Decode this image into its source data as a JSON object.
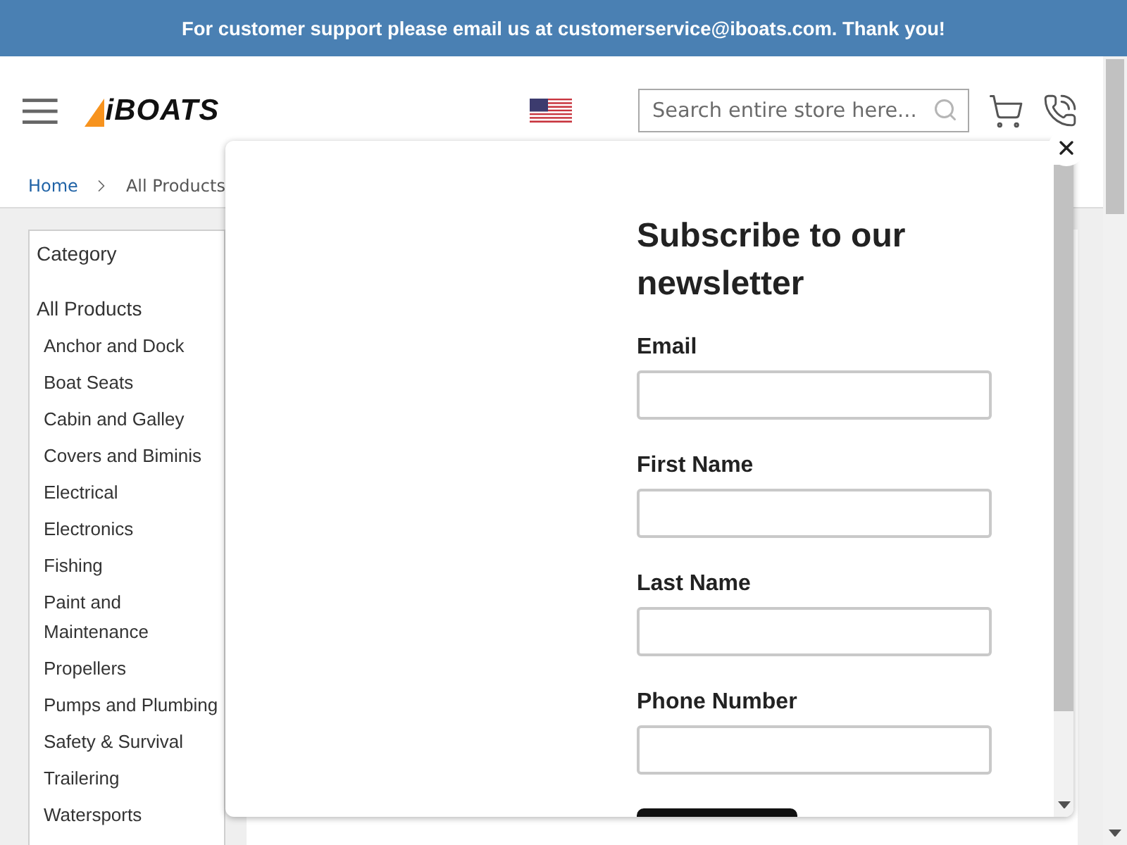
{
  "announcement": {
    "text": "For customer support please email us at customerservice@iboats.com. Thank you!"
  },
  "header": {
    "logo": "iBOATS",
    "search": {
      "placeholder": "Search entire store here..."
    }
  },
  "breadcrumb": [
    {
      "label": "Home",
      "kind": "link"
    },
    {
      "label": "All Products",
      "kind": "current"
    }
  ],
  "sidebar": {
    "title": "Category",
    "tree": {
      "label": "All Products",
      "children": [
        {
          "label": "Anchor and Dock"
        },
        {
          "label": "Boat Seats"
        },
        {
          "label": "Cabin and Galley"
        },
        {
          "label": "Covers and Biminis"
        },
        {
          "label": "Electrical"
        },
        {
          "label": "Electronics"
        },
        {
          "label": "Fishing"
        },
        {
          "label": "Paint and Maintenance"
        },
        {
          "label": "Propellers"
        },
        {
          "label": "Pumps and Plumbing"
        },
        {
          "label": "Safety & Survival"
        },
        {
          "label": "Trailering"
        },
        {
          "label": "Watersports"
        }
      ]
    }
  },
  "newsletter_popup": {
    "title": "Subscribe to our newsletter",
    "fields": [
      {
        "label": "Email"
      },
      {
        "label": "First Name"
      },
      {
        "label": "Last Name"
      },
      {
        "label": "Phone Number"
      }
    ]
  }
}
